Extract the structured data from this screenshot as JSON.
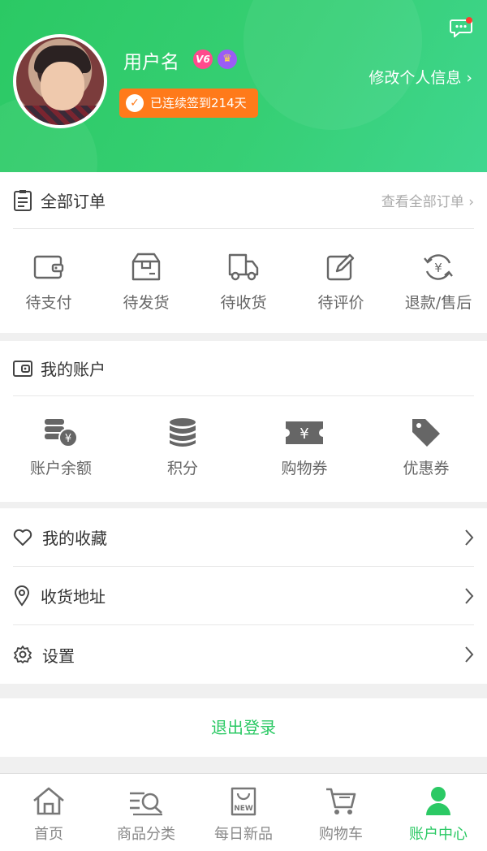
{
  "header": {
    "username": "用户名",
    "vip_badge": "V6",
    "crown_badge": "♛",
    "signin_text": "已连续签到214天",
    "edit_link": "修改个人信息 ›"
  },
  "orders": {
    "title": "全部订单",
    "more": "查看全部订单 ›",
    "items": [
      {
        "label": "待支付",
        "icon": "wallet-icon"
      },
      {
        "label": "待发货",
        "icon": "package-icon"
      },
      {
        "label": "待收货",
        "icon": "truck-icon"
      },
      {
        "label": "待评价",
        "icon": "edit-icon"
      },
      {
        "label": "退款/售后",
        "icon": "refund-icon"
      }
    ]
  },
  "account": {
    "title": "我的账户",
    "items": [
      {
        "label": "账户余额",
        "icon": "coins-icon"
      },
      {
        "label": "积分",
        "icon": "points-icon"
      },
      {
        "label": "购物券",
        "icon": "ticket-icon"
      },
      {
        "label": "优惠券",
        "icon": "tag-icon"
      }
    ]
  },
  "menu": {
    "favorites": "我的收藏",
    "address": "收货地址",
    "settings": "设置"
  },
  "logout": "退出登录",
  "tabs": [
    {
      "label": "首页",
      "icon": "home-icon"
    },
    {
      "label": "商品分类",
      "icon": "category-icon"
    },
    {
      "label": "每日新品",
      "icon": "new-bag-icon"
    },
    {
      "label": "购物车",
      "icon": "cart-icon"
    },
    {
      "label": "账户中心",
      "icon": "user-icon"
    }
  ],
  "colors": {
    "accent": "#2bc964",
    "orange": "#ff7a1a"
  }
}
